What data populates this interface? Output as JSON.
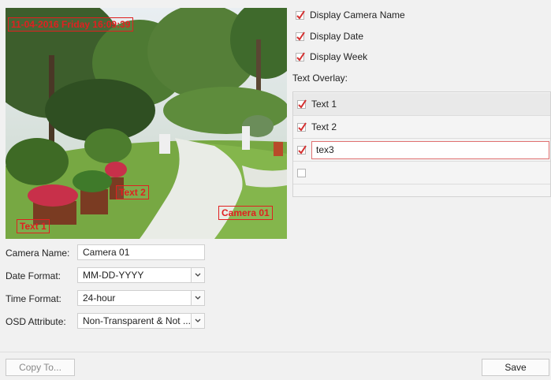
{
  "preview": {
    "osd_datetime": "11-04-2016 Friday 16:09:39",
    "osd_text1": "Text 1",
    "osd_text2": "Text 2",
    "osd_camera": "Camera 01"
  },
  "options": {
    "display_camera_name": {
      "label": "Display Camera Name",
      "checked": true
    },
    "display_date": {
      "label": "Display Date",
      "checked": true
    },
    "display_week": {
      "label": "Display Week",
      "checked": true
    }
  },
  "text_overlay": {
    "title": "Text Overlay:",
    "rows": [
      {
        "text": "Text 1",
        "checked": true
      },
      {
        "text": "Text 2",
        "checked": true
      },
      {
        "text": "tex3",
        "checked": true
      },
      {
        "text": "",
        "checked": false
      }
    ]
  },
  "form": {
    "camera_name_label": "Camera Name:",
    "camera_name_value": "Camera 01",
    "date_format_label": "Date Format:",
    "date_format_value": "MM-DD-YYYY",
    "time_format_label": "Time Format:",
    "time_format_value": "24-hour",
    "osd_attribute_label": "OSD Attribute:",
    "osd_attribute_value": "Non-Transparent & Not ..."
  },
  "buttons": {
    "copy_to": "Copy To...",
    "save": "Save"
  },
  "colors": {
    "osd_red": "#e02020",
    "check_red": "#d43030"
  }
}
